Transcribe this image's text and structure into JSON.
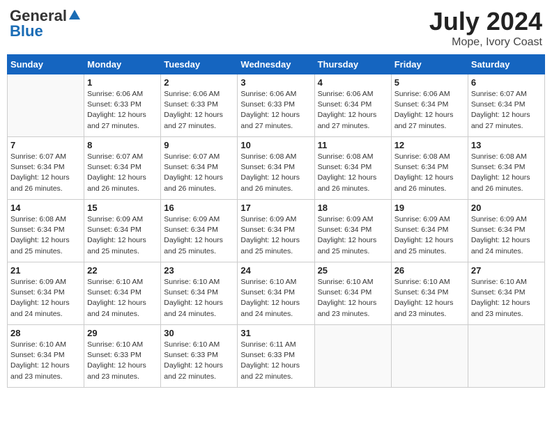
{
  "header": {
    "logo_general": "General",
    "logo_blue": "Blue",
    "month": "July 2024",
    "location": "Mope, Ivory Coast"
  },
  "days_of_week": [
    "Sunday",
    "Monday",
    "Tuesday",
    "Wednesday",
    "Thursday",
    "Friday",
    "Saturday"
  ],
  "weeks": [
    [
      {
        "day": "",
        "info": ""
      },
      {
        "day": "1",
        "info": "Sunrise: 6:06 AM\nSunset: 6:33 PM\nDaylight: 12 hours\nand 27 minutes."
      },
      {
        "day": "2",
        "info": "Sunrise: 6:06 AM\nSunset: 6:33 PM\nDaylight: 12 hours\nand 27 minutes."
      },
      {
        "day": "3",
        "info": "Sunrise: 6:06 AM\nSunset: 6:33 PM\nDaylight: 12 hours\nand 27 minutes."
      },
      {
        "day": "4",
        "info": "Sunrise: 6:06 AM\nSunset: 6:34 PM\nDaylight: 12 hours\nand 27 minutes."
      },
      {
        "day": "5",
        "info": "Sunrise: 6:06 AM\nSunset: 6:34 PM\nDaylight: 12 hours\nand 27 minutes."
      },
      {
        "day": "6",
        "info": "Sunrise: 6:07 AM\nSunset: 6:34 PM\nDaylight: 12 hours\nand 27 minutes."
      }
    ],
    [
      {
        "day": "7",
        "info": "Sunrise: 6:07 AM\nSunset: 6:34 PM\nDaylight: 12 hours\nand 26 minutes."
      },
      {
        "day": "8",
        "info": "Sunrise: 6:07 AM\nSunset: 6:34 PM\nDaylight: 12 hours\nand 26 minutes."
      },
      {
        "day": "9",
        "info": "Sunrise: 6:07 AM\nSunset: 6:34 PM\nDaylight: 12 hours\nand 26 minutes."
      },
      {
        "day": "10",
        "info": "Sunrise: 6:08 AM\nSunset: 6:34 PM\nDaylight: 12 hours\nand 26 minutes."
      },
      {
        "day": "11",
        "info": "Sunrise: 6:08 AM\nSunset: 6:34 PM\nDaylight: 12 hours\nand 26 minutes."
      },
      {
        "day": "12",
        "info": "Sunrise: 6:08 AM\nSunset: 6:34 PM\nDaylight: 12 hours\nand 26 minutes."
      },
      {
        "day": "13",
        "info": "Sunrise: 6:08 AM\nSunset: 6:34 PM\nDaylight: 12 hours\nand 26 minutes."
      }
    ],
    [
      {
        "day": "14",
        "info": "Sunrise: 6:08 AM\nSunset: 6:34 PM\nDaylight: 12 hours\nand 25 minutes."
      },
      {
        "day": "15",
        "info": "Sunrise: 6:09 AM\nSunset: 6:34 PM\nDaylight: 12 hours\nand 25 minutes."
      },
      {
        "day": "16",
        "info": "Sunrise: 6:09 AM\nSunset: 6:34 PM\nDaylight: 12 hours\nand 25 minutes."
      },
      {
        "day": "17",
        "info": "Sunrise: 6:09 AM\nSunset: 6:34 PM\nDaylight: 12 hours\nand 25 minutes."
      },
      {
        "day": "18",
        "info": "Sunrise: 6:09 AM\nSunset: 6:34 PM\nDaylight: 12 hours\nand 25 minutes."
      },
      {
        "day": "19",
        "info": "Sunrise: 6:09 AM\nSunset: 6:34 PM\nDaylight: 12 hours\nand 25 minutes."
      },
      {
        "day": "20",
        "info": "Sunrise: 6:09 AM\nSunset: 6:34 PM\nDaylight: 12 hours\nand 24 minutes."
      }
    ],
    [
      {
        "day": "21",
        "info": "Sunrise: 6:09 AM\nSunset: 6:34 PM\nDaylight: 12 hours\nand 24 minutes."
      },
      {
        "day": "22",
        "info": "Sunrise: 6:10 AM\nSunset: 6:34 PM\nDaylight: 12 hours\nand 24 minutes."
      },
      {
        "day": "23",
        "info": "Sunrise: 6:10 AM\nSunset: 6:34 PM\nDaylight: 12 hours\nand 24 minutes."
      },
      {
        "day": "24",
        "info": "Sunrise: 6:10 AM\nSunset: 6:34 PM\nDaylight: 12 hours\nand 24 minutes."
      },
      {
        "day": "25",
        "info": "Sunrise: 6:10 AM\nSunset: 6:34 PM\nDaylight: 12 hours\nand 23 minutes."
      },
      {
        "day": "26",
        "info": "Sunrise: 6:10 AM\nSunset: 6:34 PM\nDaylight: 12 hours\nand 23 minutes."
      },
      {
        "day": "27",
        "info": "Sunrise: 6:10 AM\nSunset: 6:34 PM\nDaylight: 12 hours\nand 23 minutes."
      }
    ],
    [
      {
        "day": "28",
        "info": "Sunrise: 6:10 AM\nSunset: 6:34 PM\nDaylight: 12 hours\nand 23 minutes."
      },
      {
        "day": "29",
        "info": "Sunrise: 6:10 AM\nSunset: 6:33 PM\nDaylight: 12 hours\nand 23 minutes."
      },
      {
        "day": "30",
        "info": "Sunrise: 6:10 AM\nSunset: 6:33 PM\nDaylight: 12 hours\nand 22 minutes."
      },
      {
        "day": "31",
        "info": "Sunrise: 6:11 AM\nSunset: 6:33 PM\nDaylight: 12 hours\nand 22 minutes."
      },
      {
        "day": "",
        "info": ""
      },
      {
        "day": "",
        "info": ""
      },
      {
        "day": "",
        "info": ""
      }
    ]
  ]
}
